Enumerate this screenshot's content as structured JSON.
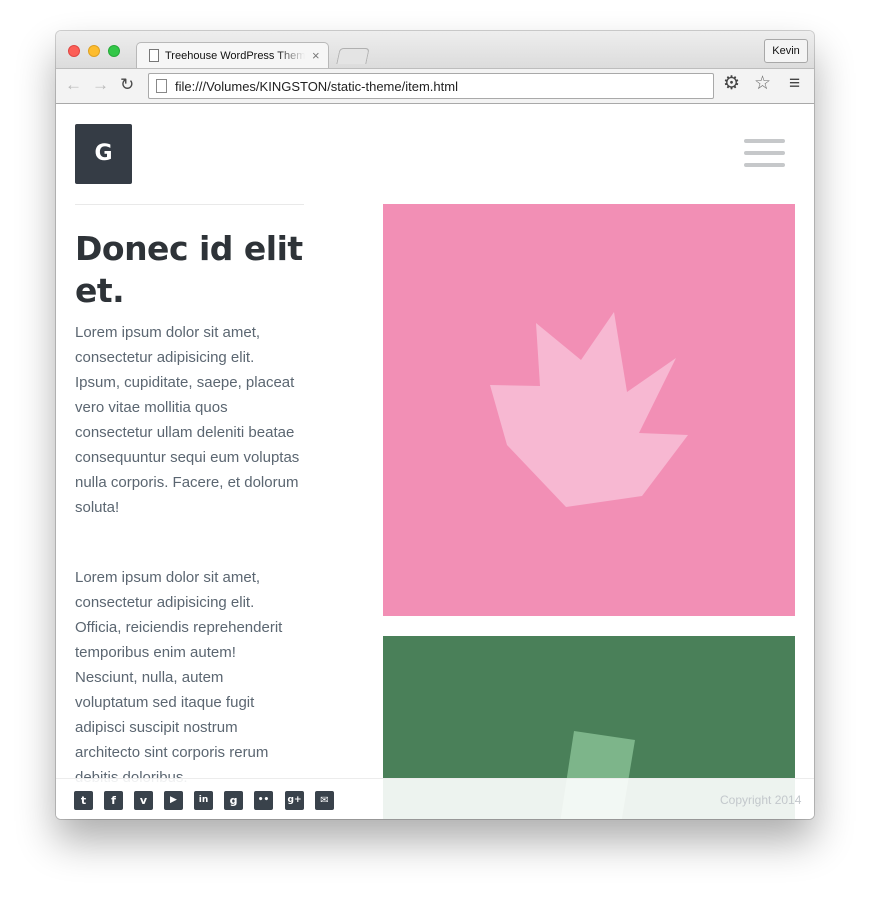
{
  "browser": {
    "tab": {
      "title": "Treehouse WordPress Theme",
      "close": "×"
    },
    "profile_name": "Kevin",
    "address_bar": {
      "url": "file:///Volumes/KINGSTON/static-theme/item.html"
    },
    "icons": [
      "back-arrow-icon",
      "forward-arrow-icon",
      "reload-icon",
      "document-icon",
      "gear-icon",
      "star-icon",
      "menu-icon"
    ]
  },
  "site": {
    "logo_letter": "G",
    "article": {
      "title": "Donec id elit et.",
      "paragraphs": [
        "Lorem ipsum dolor sit amet, consectetur adipisicing elit. Ipsum, cupiditate, saepe, placeat vero vitae mollitia quos consectetur ullam deleniti beatae consequuntur sequi eum voluptas nulla corporis. Facere, et dolorum soluta!",
        "Lorem ipsum dolor sit amet, consectetur adipisicing elit. Officia, reiciendis reprehenderit temporibus enim autem! Nesciunt, nulla, autem voluptatum sed itaque fugit adipisci suscipit nostrum architecto sint corporis rerum debitis doloribus."
      ]
    },
    "images": [
      {
        "name": "pink-star-image",
        "background": "#f28fb5",
        "shape_color": "#f7b8d2"
      },
      {
        "name": "green-image",
        "background": "#4a8059",
        "shape_color": "#7db58a"
      }
    ],
    "footer": {
      "social": [
        {
          "name": "twitter",
          "glyph": "t"
        },
        {
          "name": "facebook",
          "glyph": "f"
        },
        {
          "name": "vimeo",
          "glyph": "v"
        },
        {
          "name": "youtube",
          "glyph": "▶"
        },
        {
          "name": "linkedin",
          "glyph": "in"
        },
        {
          "name": "github",
          "glyph": "g"
        },
        {
          "name": "flickr",
          "glyph": "••"
        },
        {
          "name": "google-plus",
          "glyph": "g+"
        },
        {
          "name": "email",
          "glyph": "✉"
        }
      ],
      "copyright": "Copyright 2014"
    },
    "colors": {
      "accent_dark": "#353c45",
      "text_muted": "#5b6671",
      "heading": "#2e3338"
    }
  }
}
